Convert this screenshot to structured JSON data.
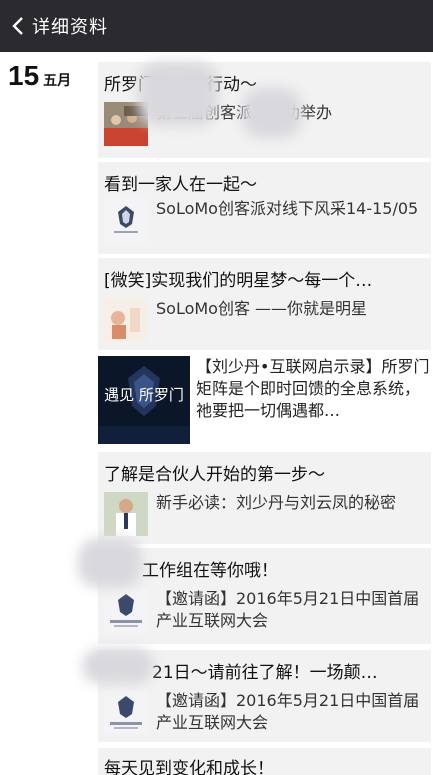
{
  "nav": {
    "title": "详细资料",
    "back_icon": "chevron-left-icon"
  },
  "date": {
    "day": "15",
    "month": "五月"
  },
  "posts": [
    {
      "title": "所罗门创客在行动～",
      "sub": "第三届创客派对成功举办"
    },
    {
      "title": "看到一家人在一起～",
      "sub": "SoLoMo创客派对线下风采14-15/05"
    },
    {
      "title": "[微笑]实现我们的明星梦～每一个…",
      "sub": "SoLoMo创客 ——你就是明星"
    },
    {
      "sub": "【刘少丹•互联网启示录】所罗门矩阵是个即时回馈的全息系统，祂要把一切偶遇都…",
      "image_text": "遇见 所罗门"
    },
    {
      "title": "了解是合伙人开始的第一步～",
      "sub": "新手必读：刘少丹与刘云凤的秘密"
    },
    {
      "title": "工作组在等你哦！",
      "sub": "【邀请函】2016年5月21日中国首届产业互联网大会"
    },
    {
      "title": "21日～请前往了解！一场颠…",
      "sub": "【邀请函】2016年5月21日中国首届产业互联网大会"
    },
    {
      "title": "每天见到变化和成长！"
    }
  ]
}
